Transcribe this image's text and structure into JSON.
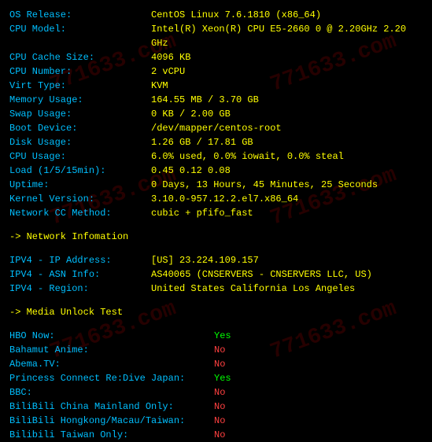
{
  "watermark": "771633.com",
  "sysinfo": {
    "os_release": {
      "label": "OS Release:",
      "value": "CentOS Linux 7.6.1810 (x86_64)"
    },
    "cpu_model": {
      "label": "CPU Model:",
      "value": "Intel(R) Xeon(R) CPU E5-2660 0 @ 2.20GHz  2.20 GHz"
    },
    "cpu_cache": {
      "label": "CPU Cache Size:",
      "value": "4096 KB"
    },
    "cpu_number": {
      "label": "CPU Number:",
      "value": "2 vCPU"
    },
    "virt_type": {
      "label": "Virt Type:",
      "value": "KVM"
    },
    "memory_usage": {
      "label": "Memory Usage:",
      "value": "164.55 MB / 3.70 GB"
    },
    "swap_usage": {
      "label": "Swap Usage:",
      "value": "0 KB / 2.00 GB"
    },
    "boot_device": {
      "label": "Boot Device:",
      "value": "/dev/mapper/centos-root"
    },
    "disk_usage": {
      "label": "Disk Usage:",
      "value": "1.26 GB / 17.81 GB"
    },
    "cpu_usage": {
      "label": "CPU Usage:",
      "value": "6.0% used, 0.0% iowait, 0.0% steal"
    },
    "load": {
      "label": "Load (1/5/15min):",
      "value": "0.45 0.12 0.08"
    },
    "uptime": {
      "label": "Uptime:",
      "value": "0 Days, 13 Hours, 45 Minutes, 25 Seconds"
    },
    "kernel": {
      "label": "Kernel Version:",
      "value": "3.10.0-957.12.2.el7.x86_64"
    },
    "cc_method": {
      "label": "Network CC Method:",
      "value": "cubic + pfifo_fast"
    }
  },
  "sections": {
    "network": "-> Network Infomation",
    "media": "-> Media Unlock Test"
  },
  "network": {
    "ipv4_ip": {
      "label": "IPV4 - IP Address:",
      "value": "[US] 23.224.109.157"
    },
    "ipv4_asn": {
      "label": "IPV4 - ASN Info:",
      "value": "AS40065 (CNSERVERS - CNSERVERS LLC, US)"
    },
    "ipv4_region": {
      "label": "IPV4 - Region:",
      "value": "United States California Los Angeles"
    }
  },
  "media": {
    "hbo": {
      "label": "HBO Now:",
      "value": "Yes",
      "status": "yes"
    },
    "bahamut": {
      "label": "Bahamut Anime:",
      "value": "No",
      "status": "no"
    },
    "abema": {
      "label": "Abema.TV:",
      "value": "No",
      "status": "no"
    },
    "princess": {
      "label": "Princess Connect Re:Dive Japan:",
      "value": "Yes",
      "status": "yes"
    },
    "bbc": {
      "label": "BBC:",
      "value": "No",
      "status": "no"
    },
    "bili_cn": {
      "label": "BiliBili China Mainland Only:",
      "value": "No",
      "status": "no"
    },
    "bili_hk": {
      "label": "BiliBili Hongkong/Macau/Taiwan:",
      "value": "No",
      "status": "no"
    },
    "bili_tw": {
      "label": "Bilibili Taiwan Only:",
      "value": "No",
      "status": "no"
    }
  }
}
